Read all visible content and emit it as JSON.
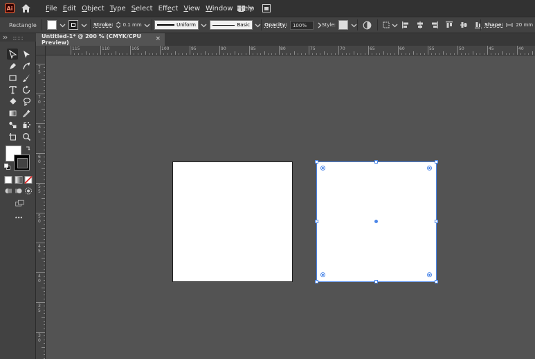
{
  "app": {
    "logo_text": "Ai",
    "menu": [
      {
        "label": "File",
        "underline": "F",
        "rest": "ile"
      },
      {
        "label": "Edit",
        "underline": "E",
        "rest": "dit"
      },
      {
        "label": "Object",
        "underline": "O",
        "rest": "bject"
      },
      {
        "label": "Type",
        "underline": "T",
        "rest": "ype"
      },
      {
        "label": "Select",
        "underline": "S",
        "rest": "elect"
      },
      {
        "label": "Effect",
        "pre": "Eff",
        "underline": "e",
        "rest": "ct"
      },
      {
        "label": "View",
        "underline": "V",
        "rest": "iew"
      },
      {
        "label": "Window",
        "underline": "W",
        "rest": "indow"
      },
      {
        "label": "Help",
        "underline": "H",
        "rest": "elp"
      }
    ]
  },
  "control_bar": {
    "object_type": "Rectangle",
    "stroke_label": "Stroke:",
    "stroke_weight": "0.1 mm",
    "stroke_profile": "Uniform",
    "brush": "Basic",
    "opacity_label": "Opacity:",
    "opacity_value": "100%",
    "style_label": "Style:",
    "shape_label": "Shape:",
    "shape_width": "20 mm",
    "fill_color": "#ffffff"
  },
  "document": {
    "tab_title": "Untitled-1* @ 200 % (CMYK/CPU Preview)",
    "close_glyph": "×"
  },
  "rulers": {
    "horizontal": [
      "115",
      "110",
      "105",
      "100",
      "95",
      "90",
      "85",
      "80",
      "75",
      "70",
      "65",
      "60",
      "55",
      "50",
      "45",
      "40"
    ],
    "vertical": [
      "7",
      "7",
      "6",
      "6",
      "5",
      "5",
      "4",
      "4",
      "3",
      "3"
    ],
    "vertical_sub": [
      "5",
      "0",
      "5",
      "0",
      "5",
      "0",
      "5",
      "0",
      "5",
      "0"
    ]
  },
  "tools": {
    "more_glyph": "•••"
  },
  "colors": {
    "selection": "#4b86e8",
    "workspace": "#535353",
    "panel": "#424242",
    "menubar": "#323232"
  }
}
